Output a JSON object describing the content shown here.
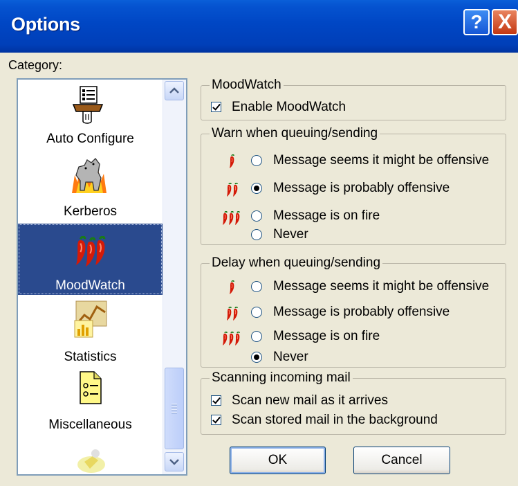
{
  "window": {
    "title": "Options",
    "help_button": "?",
    "close_button": "X"
  },
  "category": {
    "label": "Category:",
    "items": [
      {
        "label": "Auto Configure",
        "icon": "auto-configure-icon"
      },
      {
        "label": "Kerberos",
        "icon": "kerberos-dog-icon"
      },
      {
        "label": "MoodWatch",
        "icon": "chili-peppers-icon",
        "selected": true
      },
      {
        "label": "Statistics",
        "icon": "statistics-icon"
      },
      {
        "label": "Miscellaneous",
        "icon": "miscellaneous-icon"
      }
    ]
  },
  "moodwatch_group": {
    "title": "MoodWatch",
    "enable": {
      "label": "Enable MoodWatch",
      "checked": true
    }
  },
  "warn_group": {
    "title": "Warn when queuing/sending",
    "options": [
      {
        "label": "Message seems it might be offensive",
        "peppers": 1,
        "selected": false
      },
      {
        "label": "Message is probably offensive",
        "peppers": 2,
        "selected": true
      },
      {
        "label": "Message is on fire",
        "peppers": 3,
        "selected": false
      },
      {
        "label": "Never",
        "peppers": 0,
        "selected": false
      }
    ]
  },
  "delay_group": {
    "title": "Delay when queuing/sending",
    "options": [
      {
        "label": "Message seems it might be offensive",
        "peppers": 1,
        "selected": false
      },
      {
        "label": "Message is probably offensive",
        "peppers": 2,
        "selected": false
      },
      {
        "label": "Message is on fire",
        "peppers": 3,
        "selected": false
      },
      {
        "label": "Never",
        "peppers": 0,
        "selected": true
      }
    ]
  },
  "scanning_group": {
    "title": "Scanning incoming mail",
    "options": [
      {
        "label": "Scan new mail as it arrives",
        "checked": true
      },
      {
        "label": "Scan stored mail in the background",
        "checked": true
      }
    ]
  },
  "buttons": {
    "ok": "OK",
    "cancel": "Cancel"
  },
  "colors": {
    "title_bar": "#0046c4",
    "selection": "#2a4a8e",
    "pepper": "#cc1100"
  }
}
